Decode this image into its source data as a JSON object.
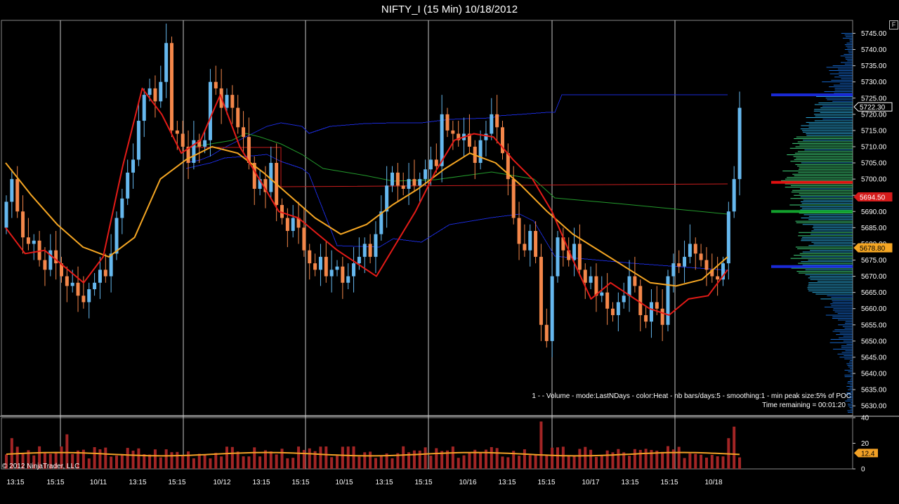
{
  "title": "NIFTY_I (15 Min)  10/18/2012",
  "f_button": "F",
  "copyright": "© 2012 NinjaTrader, LLC",
  "indicator_info": "1 -   - Volume - mode:LastNDays  - color:Heat - nb bars/days:5 - smoothing:1 - min peak size:5% of POC",
  "time_remaining": "Time remaining = 00:01:20",
  "colors": {
    "up": "#66b8ee",
    "down": "#f4874a",
    "ema_fast": "#e41b17",
    "ema_slow": "#f5a623",
    "vwap_green": "#239a2c",
    "blue_line": "#1a2ad6",
    "red_line": "#c81d1d",
    "vol_bar": "#a32525",
    "vol_avg": "#f2a126",
    "grid": "#c8c8c8"
  },
  "chart_data": [
    {
      "type": "candlestick",
      "title": "NIFTY_I (15 Min)",
      "x_tick_labels": [
        "13:15",
        "15:15",
        "10/11",
        "13:15",
        "15:15",
        "10/12",
        "13:15",
        "15:15",
        "10/15",
        "13:15",
        "15:15",
        "10/16",
        "13:15",
        "15:15",
        "10/17",
        "13:15",
        "15:15",
        "10/18"
      ],
      "y_tick_labels": [
        "5745.00",
        "5740.00",
        "5735.00",
        "5730.00",
        "5725.00",
        "5720.00",
        "5715.00",
        "5710.00",
        "5705.00",
        "5700.00",
        "5695.00",
        "5690.00",
        "5685.00",
        "5680.00",
        "5675.00",
        "5670.00",
        "5665.00",
        "5660.00",
        "5655.00",
        "5650.00",
        "5645.00",
        "5640.00",
        "5635.00",
        "5630.00"
      ],
      "ylim": [
        5628,
        5751
      ],
      "price_badges": [
        {
          "label": "5722.30",
          "value": 5722.3,
          "color": "#000000",
          "text_color": "#ffffff"
        },
        {
          "label": "5694.50",
          "value": 5694.5,
          "color": "#d61b1b",
          "text_color": "#ffffff"
        },
        {
          "label": "5678.80",
          "value": 5678.8,
          "color": "#f5a623",
          "text_color": "#000000"
        }
      ],
      "series_close": [
        5693,
        5700,
        5690,
        5682,
        5680,
        5681,
        5675,
        5672,
        5678,
        5674,
        5670,
        5667,
        5668,
        5664,
        5662,
        5666,
        5668,
        5672,
        5670,
        5677,
        5688,
        5694,
        5702,
        5706,
        5718,
        5726,
        5728,
        5724,
        5730,
        5742,
        5715,
        5714,
        5710,
        5705,
        5712,
        5710,
        5712,
        5730,
        5728,
        5722,
        5726,
        5722,
        5716,
        5713,
        5705,
        5697,
        5700,
        5696,
        5705,
        5692,
        5688,
        5684,
        5688,
        5685,
        5678,
        5674,
        5672,
        5676,
        5670,
        5672,
        5673,
        5668,
        5670,
        5674,
        5676,
        5680,
        5676,
        5683,
        5690,
        5698,
        5702,
        5698,
        5697,
        5700,
        5698,
        5700,
        5703,
        5706,
        5704,
        5720,
        5715,
        5714,
        5712,
        5714,
        5710,
        5705,
        5712,
        5714,
        5720,
        5716,
        5708,
        5700,
        5688,
        5680,
        5678,
        5684,
        5676,
        5655,
        5650,
        5670,
        5682,
        5678,
        5675,
        5680,
        5672,
        5668,
        5670,
        5664,
        5665,
        5660,
        5658,
        5662,
        5664,
        5670,
        5667,
        5658,
        5656,
        5662,
        5660,
        5655,
        5670,
        5674,
        5673,
        5676,
        5680,
        5677,
        5675,
        5672,
        5670,
        5669,
        5674,
        5690,
        5700,
        5722
      ],
      "ema_fast_points": [
        5685,
        5677,
        5678,
        5673,
        5668,
        5676,
        5704,
        5728,
        5720,
        5708,
        5712,
        5726,
        5710,
        5700,
        5690,
        5688,
        5683,
        5678,
        5674,
        5670,
        5680,
        5690,
        5702,
        5712,
        5714,
        5713,
        5706,
        5700,
        5690,
        5676,
        5663,
        5668,
        5664,
        5660,
        5658,
        5663,
        5664,
        5672
      ],
      "ema_slow_points": [
        5705,
        5695,
        5686,
        5679,
        5676,
        5682,
        5700,
        5706,
        5710,
        5708,
        5702,
        5695,
        5688,
        5683,
        5686,
        5692,
        5697,
        5703,
        5708,
        5705,
        5698,
        5690,
        5683,
        5678,
        5673,
        5668,
        5667,
        5669,
        5676
      ],
      "value_area_levels": {
        "poc": 5699,
        "vah": 5726,
        "val": 5673
      }
    },
    {
      "type": "bar",
      "title": "Volume",
      "y_tick_labels": [
        "40",
        "20",
        "0"
      ],
      "ylim": [
        0,
        40
      ],
      "current_badge": {
        "label": "12.4",
        "value": 12.4
      },
      "average": 12.4
    }
  ]
}
